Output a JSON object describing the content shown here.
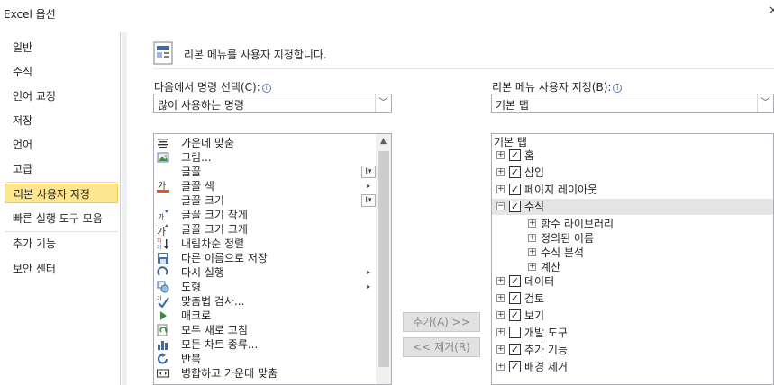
{
  "window": {
    "title": "Excel 옵션",
    "close_glyph": "×"
  },
  "sidebar": {
    "items": [
      {
        "label": "일반",
        "selected": false
      },
      {
        "label": "수식",
        "selected": false
      },
      {
        "label": "언어 교정",
        "selected": false
      },
      {
        "label": "저장",
        "selected": false
      },
      {
        "label": "언어",
        "selected": false
      },
      {
        "label": "고급",
        "selected": false
      },
      {
        "label": "리본 사용자 지정",
        "selected": true
      },
      {
        "label": "빠른 실행 도구 모음",
        "selected": false
      },
      {
        "label": "추가 기능",
        "selected": false
      },
      {
        "label": "보안 센터",
        "selected": false
      }
    ]
  },
  "header": {
    "text": "리본 메뉴를 사용자 지정합니다."
  },
  "left_panel": {
    "label": "다음에서 명령 선택(C):",
    "dropdown_value": "많이 사용하는 명령",
    "commands": [
      {
        "label": "가운데 맞춤",
        "icon": "center-align-icon"
      },
      {
        "label": "그림...",
        "icon": "picture-icon"
      },
      {
        "label": "글꼴",
        "icon": "none",
        "widget": "I▾"
      },
      {
        "label": "글꼴 색",
        "icon": "font-color-icon",
        "widget": "▸"
      },
      {
        "label": "글꼴 크기",
        "icon": "none",
        "widget": "I▾"
      },
      {
        "label": "글꼴 크기 작게",
        "icon": "decrease-font-icon"
      },
      {
        "label": "글꼴 크기 크게",
        "icon": "increase-font-icon"
      },
      {
        "label": "내림차순 정렬",
        "icon": "sort-descending-icon"
      },
      {
        "label": "다른 이름으로 저장",
        "icon": "save-as-icon"
      },
      {
        "label": "다시 실행",
        "icon": "redo-icon",
        "widget": "▸"
      },
      {
        "label": "도형",
        "icon": "shapes-icon",
        "widget": "▸"
      },
      {
        "label": "맞춤법 검사...",
        "icon": "spelling-icon"
      },
      {
        "label": "매크로",
        "icon": "macro-icon"
      },
      {
        "label": "모두 새로 고침",
        "icon": "refresh-all-icon"
      },
      {
        "label": "모든 차트 종류...",
        "icon": "chart-types-icon"
      },
      {
        "label": "반복",
        "icon": "repeat-icon"
      },
      {
        "label": "병합하고 가운데 맞춤",
        "icon": "merge-center-icon"
      }
    ]
  },
  "buttons": {
    "add": "추가(A) >>",
    "remove": "<< 제거(R)"
  },
  "right_panel": {
    "label": "리본 메뉴 사용자 지정(B):",
    "dropdown_value": "기본 탭",
    "tree_header": "기본 탭",
    "tabs": [
      {
        "label": "홈",
        "checked": true,
        "expanded": false
      },
      {
        "label": "삽입",
        "checked": true,
        "expanded": false
      },
      {
        "label": "페이지 레이아웃",
        "checked": true,
        "expanded": false
      },
      {
        "label": "수식",
        "checked": true,
        "expanded": true,
        "children": [
          "함수 라이브러리",
          "정의된 이름",
          "수식 분석",
          "계산"
        ]
      },
      {
        "label": "데이터",
        "checked": true,
        "expanded": false
      },
      {
        "label": "검토",
        "checked": true,
        "expanded": false
      },
      {
        "label": "보기",
        "checked": true,
        "expanded": false
      },
      {
        "label": "개발 도구",
        "checked": false,
        "expanded": false
      },
      {
        "label": "추가 기능",
        "checked": true,
        "expanded": false
      },
      {
        "label": "배경 제거",
        "checked": true,
        "expanded": false
      }
    ]
  },
  "colors": {
    "selection_bg": "#fce68f",
    "selection_border": "#f2c94c",
    "highlight_row": "#e5e5e5",
    "info_blue": "#4a7ebb"
  }
}
